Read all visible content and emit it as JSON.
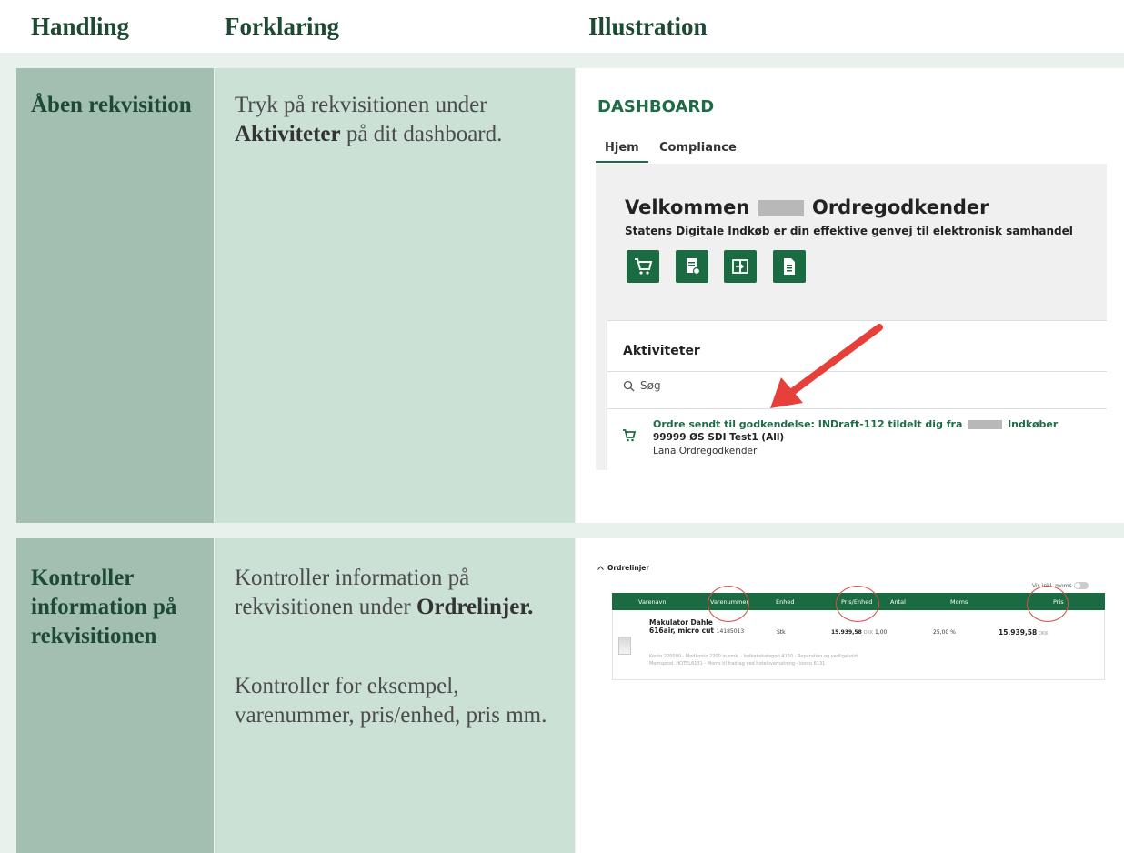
{
  "headers": {
    "handling": "Handling",
    "forklaring": "Forklaring",
    "illustration": "Illustration"
  },
  "rows": [
    {
      "handling": "Åben rekvisition",
      "forklaring": {
        "pre": "Tryk på rekvisitionen under ",
        "bold": "Aktiviteter",
        "post": " på dit dashboard."
      }
    },
    {
      "handling": "Kontroller information på rekvisitionen",
      "forklaring": {
        "p1_pre": "Kontroller information på rekvisitionen under ",
        "p1_bold": "Ordrelinjer.",
        "p2": "Kontroller for eksempel, varenummer, pris/enhed, pris mm."
      }
    }
  ],
  "dashboard": {
    "title": "DASHBOARD",
    "tabs": [
      "Hjem",
      "Compliance"
    ],
    "welcome_pre": "Velkommen",
    "welcome_post": "Ordregodkender",
    "subtitle": "Statens Digitale Indkøb er din effektive genvej til elektronisk samhandel",
    "quick_icons": [
      "cart-icon",
      "document-arrow-icon",
      "transfer-icon",
      "document-icon"
    ],
    "activities": {
      "title": "Aktiviteter",
      "search_placeholder": "Søg",
      "item": {
        "line1_pre": "Ordre sendt til godkendelse: INDraft-112 tildelt dig fra",
        "line1_post": "Indkøber",
        "line2": "99999 ØS SDI Test1 (All)",
        "line3": "Lana Ordregodkender"
      }
    },
    "colors": {
      "brand_green": "#1e6b45",
      "arrow_red": "#e5403a"
    }
  },
  "order_lines": {
    "title": "Ordrelinjer",
    "toggle_label": "Vis inkl. moms",
    "columns": [
      "Varenavn",
      "Varenummer",
      "Enhed",
      "Pris/Enhed",
      "Antal",
      "Moms",
      "Pris"
    ],
    "row": {
      "name_line1": "Makulator Dahle",
      "name_line2": "616air, micro cut",
      "varenummer": "14185013",
      "enhed": "Stk",
      "pris_enhed": "15.939,58",
      "currency": "DKK",
      "antal": "1,00",
      "moms": "25,00 %",
      "pris": "15.939,58",
      "meta1": "Konto 220000 - Modkonto 2200 in.omk. · Indkøbskategori 4150 - Reparation og vedligehold",
      "meta2": "Momsprod. HOTEL6131 - Moms til fradrag ved hotelovernatning - konto 6131"
    }
  }
}
